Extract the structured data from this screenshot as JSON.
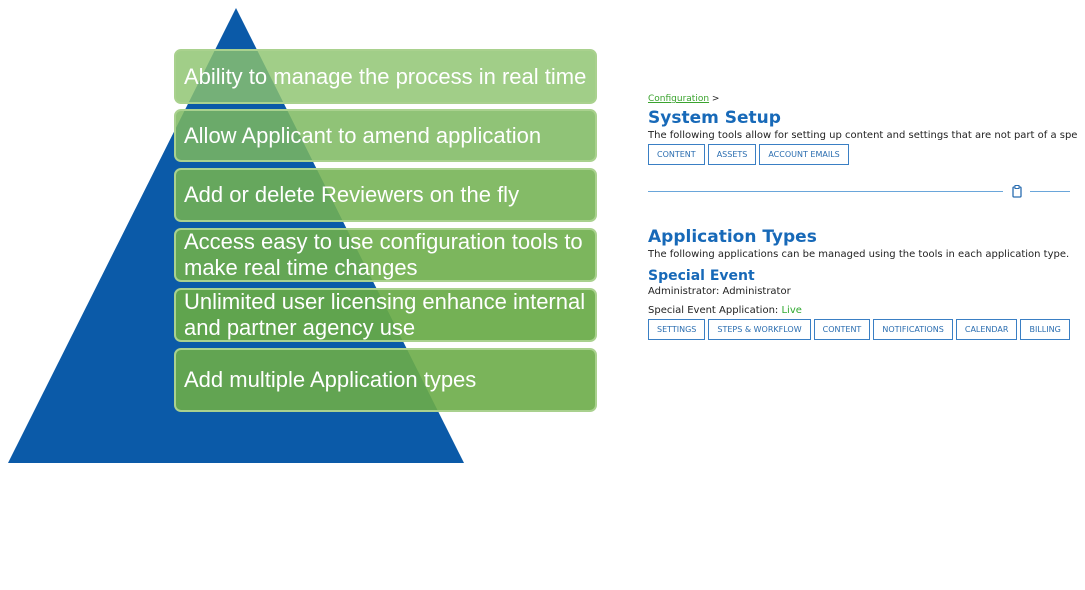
{
  "pyramid": {
    "color": "#0b5aa8",
    "items": [
      "Ability to manage the process in real time",
      "Allow Applicant to amend application",
      "Add or delete Reviewers on the fly",
      "Access easy to use configuration tools to make real time changes",
      "Unlimited user licensing enhance internal and partner agency use",
      "Add multiple Application types"
    ]
  },
  "screenshot": {
    "breadcrumb": {
      "link": "Configuration",
      "separator": ">"
    },
    "system_setup": {
      "title": "System Setup",
      "description": "The following tools allow for setting up content and settings that are not part of a spe",
      "buttons": [
        "CONTENT",
        "ASSETS",
        "ACCOUNT EMAILS"
      ]
    },
    "divider_icon": "clipboard-icon",
    "application_types": {
      "title": "Application Types",
      "description": "The following applications can be managed using the tools in each application type."
    },
    "special_event": {
      "title": "Special Event",
      "admin_label": "Administrator: Administrator",
      "status_label": "Special Event Application:",
      "status_value": "Live",
      "status_color": "#2ea82e",
      "buttons": [
        "SETTINGS",
        "STEPS & WORKFLOW",
        "CONTENT",
        "NOTIFICATIONS",
        "CALENDAR",
        "BILLING"
      ]
    }
  }
}
